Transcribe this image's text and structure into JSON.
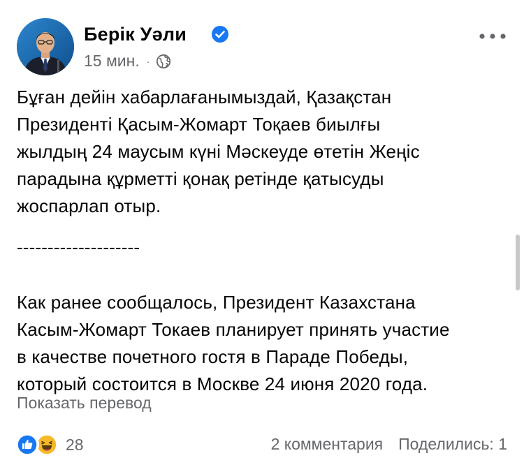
{
  "author": {
    "name": "Берік Уәли",
    "verified": true,
    "time": "15 мин.",
    "separator": "·",
    "audience_icon": "globe-icon"
  },
  "post": {
    "paragraph_kz": "Бұған дейін хабарлағанымыздай, Қазақстан\nПрезиденті Қасым-Жомарт Тоқаев биылғы\nжылдың 24 маусым күні Мәскеуде өтетін Жеңіс\nпарадына құрметті қонақ ретінде қатысуды\nжоспарлап отыр.",
    "separator_line": "--------------------",
    "paragraph_ru": "Как ранее сообщалось, Президент Казахстана\nКасым-Жомарт Токаев планирует принять участие\nв качестве почетного гостя в Параде Победы,\nкоторый состоится в Москве 24 июня 2020 года."
  },
  "translate_link": "Показать перевод",
  "footer": {
    "reactions_count": "28",
    "reaction_icons": [
      "like-icon",
      "haha-icon"
    ],
    "comments": "2 комментария",
    "shares": "Поделились: 1"
  },
  "colors": {
    "text": "#050505",
    "secondary": "#65676b",
    "brand_blue": "#1877f2",
    "haha_yellow": "#f7b928"
  }
}
